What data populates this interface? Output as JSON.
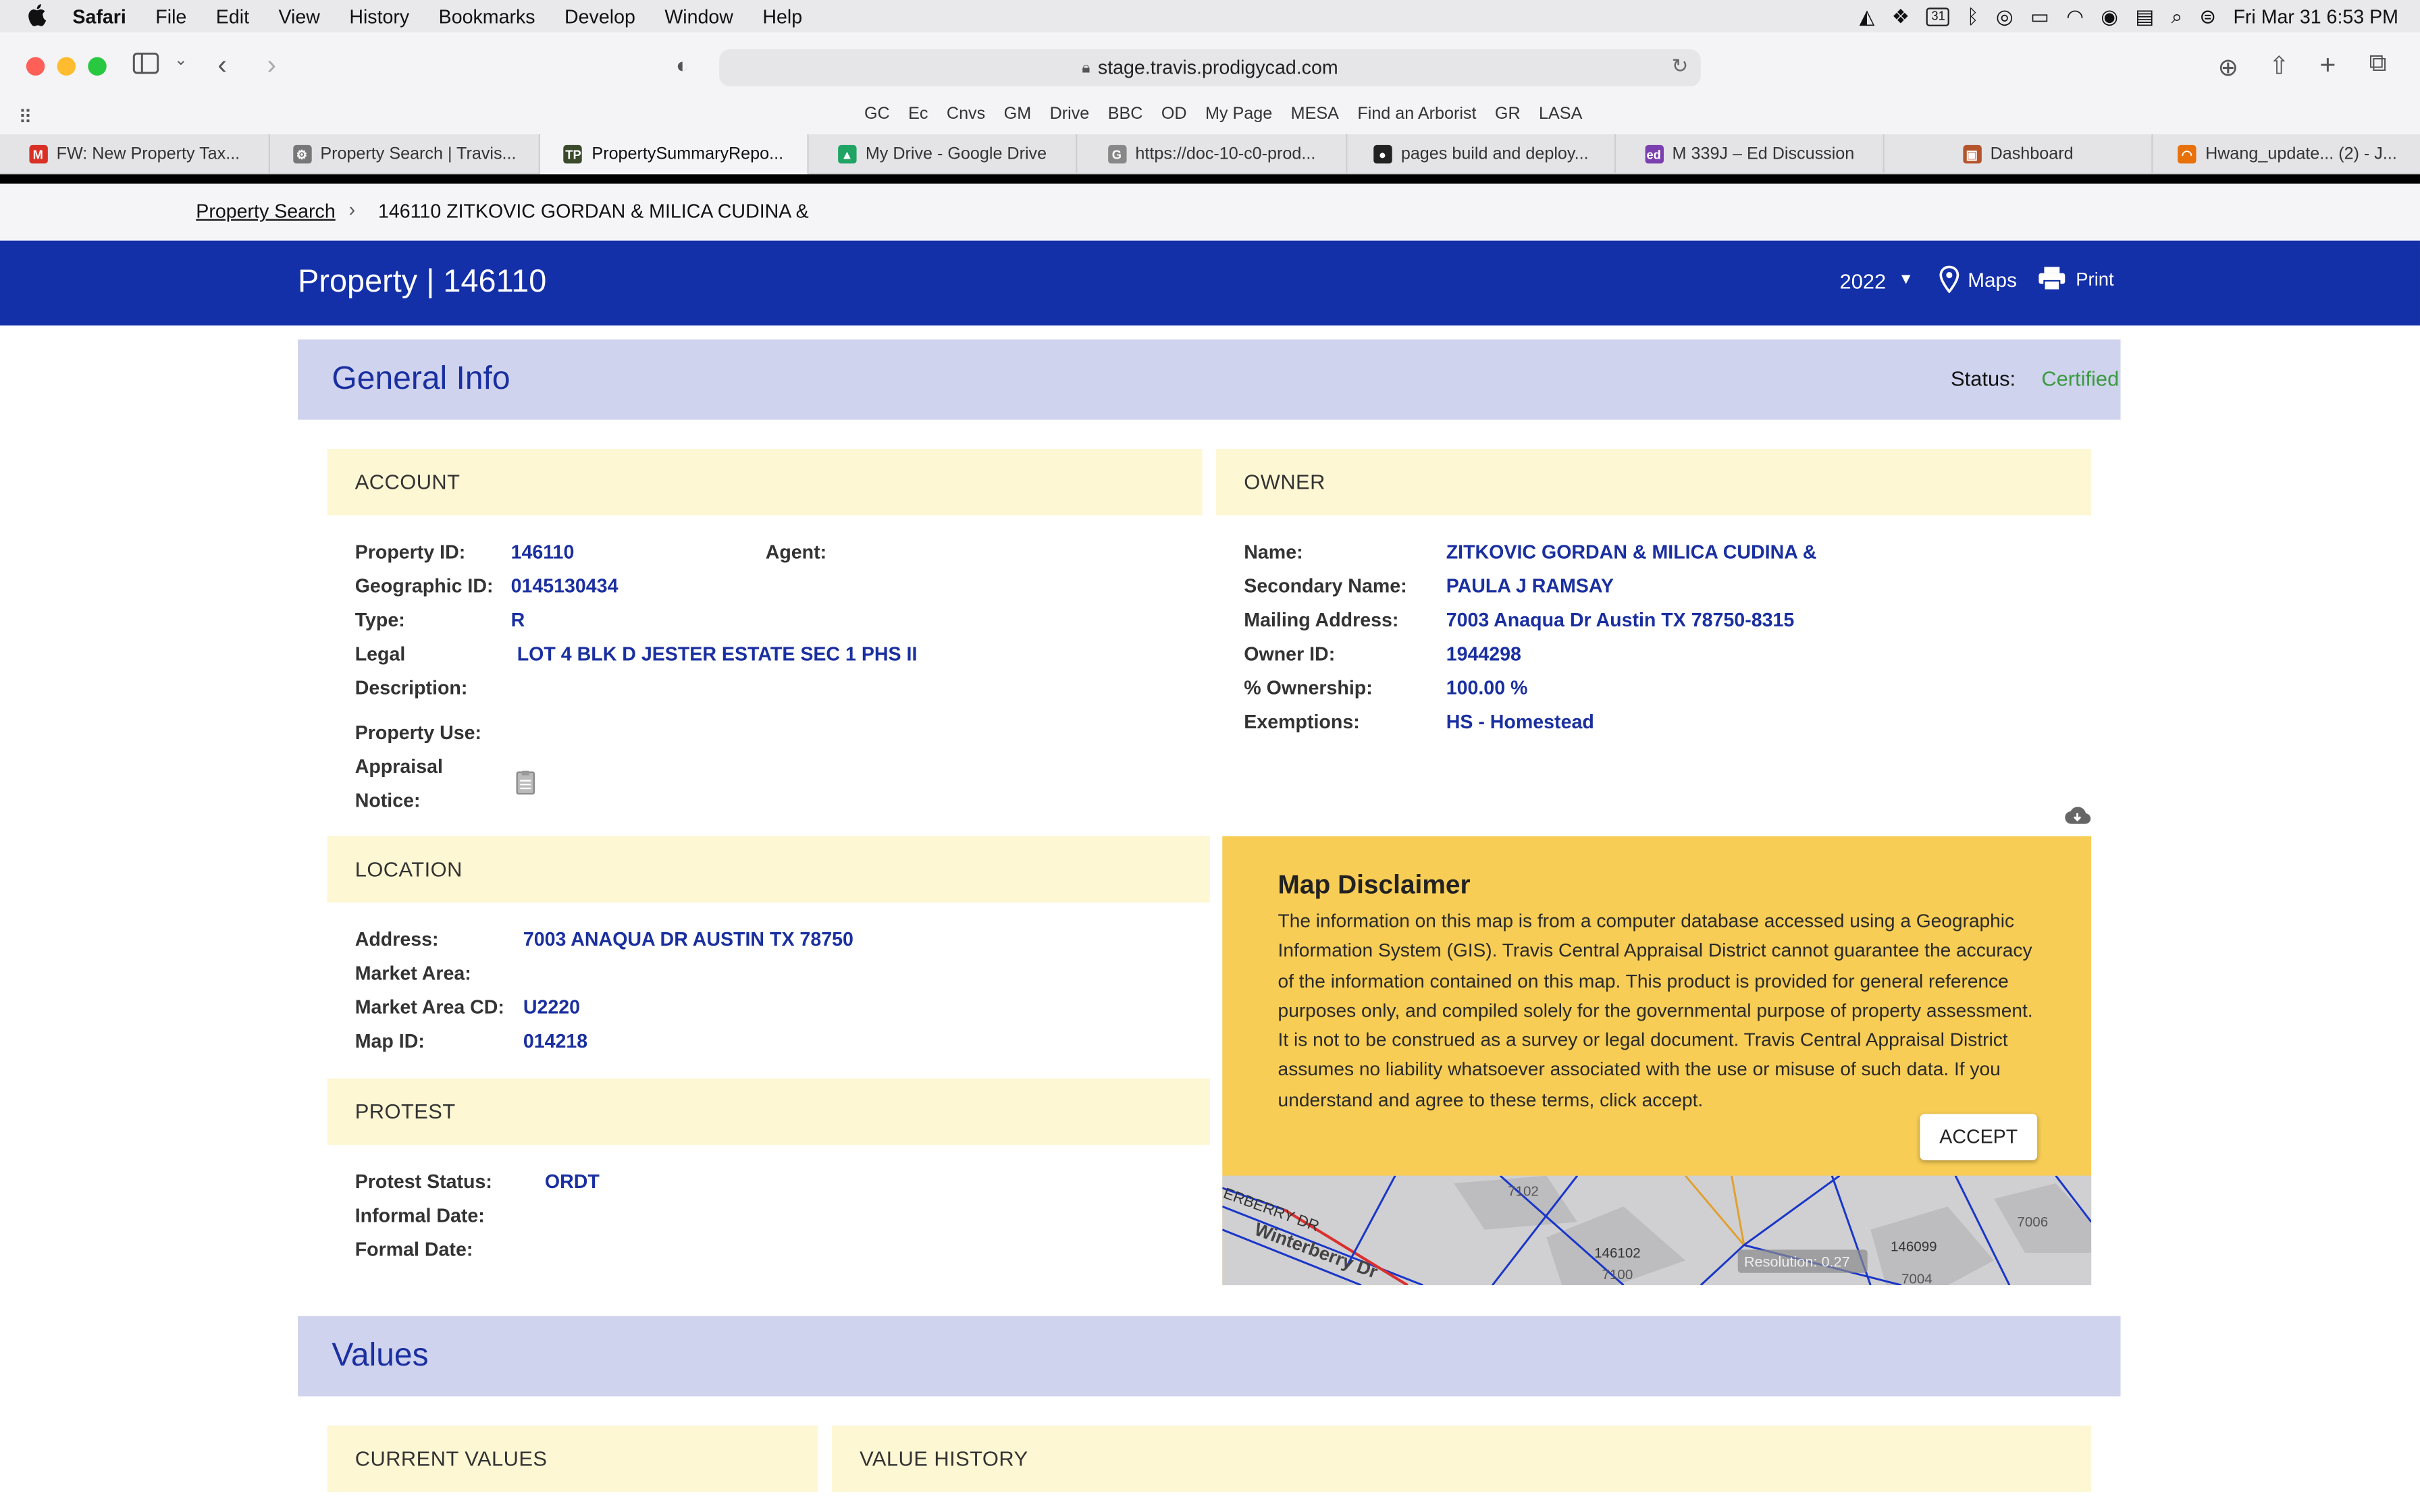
{
  "menubar": {
    "app": "Safari",
    "items": [
      "File",
      "Edit",
      "View",
      "History",
      "Bookmarks",
      "Develop",
      "Window",
      "Help"
    ],
    "calendar_day": "31",
    "clock": "Fri Mar 31  6:53 PM"
  },
  "browser": {
    "url": "stage.travis.prodigycad.com",
    "favorites": [
      "GC",
      "Ec",
      "Cnvs",
      "GM",
      "Drive",
      "BBC",
      "OD",
      "My Page",
      "MESA",
      "Find an Arborist",
      "GR",
      "LASA"
    ],
    "tabs": [
      {
        "label": "FW: New Property Tax...",
        "icon": "M",
        "color": "#d93025",
        "active": false
      },
      {
        "label": "Property Search | Travis...",
        "icon": "⚙",
        "color": "#777",
        "active": false
      },
      {
        "label": "PropertySummaryRepo...",
        "icon": "TP",
        "color": "#3a4a2a",
        "active": true
      },
      {
        "label": "My Drive - Google Drive",
        "icon": "▲",
        "color": "#1fa463",
        "active": false
      },
      {
        "label": "https://doc-10-c0-prod...",
        "icon": "G",
        "color": "#888",
        "active": false
      },
      {
        "label": "pages build and deploy...",
        "icon": "●",
        "color": "#222",
        "active": false
      },
      {
        "label": "M 339J – Ed Discussion",
        "icon": "ed",
        "color": "#7b3fb0",
        "active": false
      },
      {
        "label": "Dashboard",
        "icon": "▣",
        "color": "#b5552b",
        "active": false
      },
      {
        "label": "Hwang_update... (2) - J...",
        "icon": "◠",
        "color": "#e8710a",
        "active": false
      }
    ]
  },
  "breadcrumb": {
    "link": "Property Search",
    "separator": "›",
    "current": "146110 ZITKOVIC GORDAN & MILICA CUDINA &"
  },
  "header": {
    "title": "Property | 146110",
    "year": "2022",
    "maps": "Maps",
    "print": "Print"
  },
  "general_info": {
    "title": "General Info",
    "status_label": "Status:",
    "status_value": "Certified"
  },
  "account": {
    "heading": "ACCOUNT",
    "property_id_label": "Property ID:",
    "property_id": "146110",
    "agent_label": "Agent:",
    "geo_id_label": "Geographic ID:",
    "geo_id": "0145130434",
    "type_label": "Type:",
    "type": "R",
    "legal_label_1": "Legal",
    "legal_label_2": "Description:",
    "legal": "LOT 4 BLK D JESTER ESTATE SEC 1 PHS II",
    "use_label": "Property Use:",
    "notice_label_1": "Appraisal",
    "notice_label_2": "Notice:"
  },
  "owner": {
    "heading": "OWNER",
    "name_label": "Name:",
    "name": "ZITKOVIC GORDAN & MILICA CUDINA &",
    "secondary_label": "Secondary Name:",
    "secondary": "PAULA J RAMSAY",
    "mailing_label": "Mailing Address:",
    "mailing": "7003 Anaqua Dr Austin TX 78750-8315",
    "owner_id_label": "Owner ID:",
    "owner_id": "1944298",
    "ownership_label": "% Ownership:",
    "ownership": "100.00 %",
    "exemptions_label": "Exemptions:",
    "exemptions": "HS - Homestead"
  },
  "location": {
    "heading": "LOCATION",
    "address_label": "Address:",
    "address": "7003 ANAQUA DR AUSTIN TX 78750",
    "market_area_label": "Market Area:",
    "market_cd_label": "Market Area CD:",
    "market_cd": "U2220",
    "map_id_label": "Map ID:",
    "map_id": "014218"
  },
  "protest": {
    "heading": "PROTEST",
    "status_label": "Protest Status:",
    "status": "ORDT",
    "informal_label": "Informal Date:",
    "formal_label": "Formal Date:"
  },
  "map": {
    "title": "Map Disclaimer",
    "text": "The information on this map is from a computer database accessed using a Geographic Information System (GIS). Travis Central Appraisal District cannot guarantee the accuracy of the information contained on this map. This product is provided for general reference purposes only, and compiled solely for the governmental purpose of property assessment. It is not to be construed as a survey or legal document. Travis Central Appraisal District assumes no liability whatsoever associated with the use or misuse of such data. If you understand and agree to these terms, click accept.",
    "accept": "ACCEPT",
    "labels": [
      "7102",
      "146102",
      "7100",
      "146099",
      "7006",
      "7004"
    ],
    "street_1": "ERBERRY DR",
    "street_2": "Winterberry Dr",
    "resolution": "Resolution: 0.27"
  },
  "values": {
    "title": "Values",
    "current": "CURRENT VALUES",
    "history": "VALUE HISTORY"
  },
  "icons": {
    "appraisal_notice": "document-icon",
    "download": "cloud-download-icon"
  }
}
